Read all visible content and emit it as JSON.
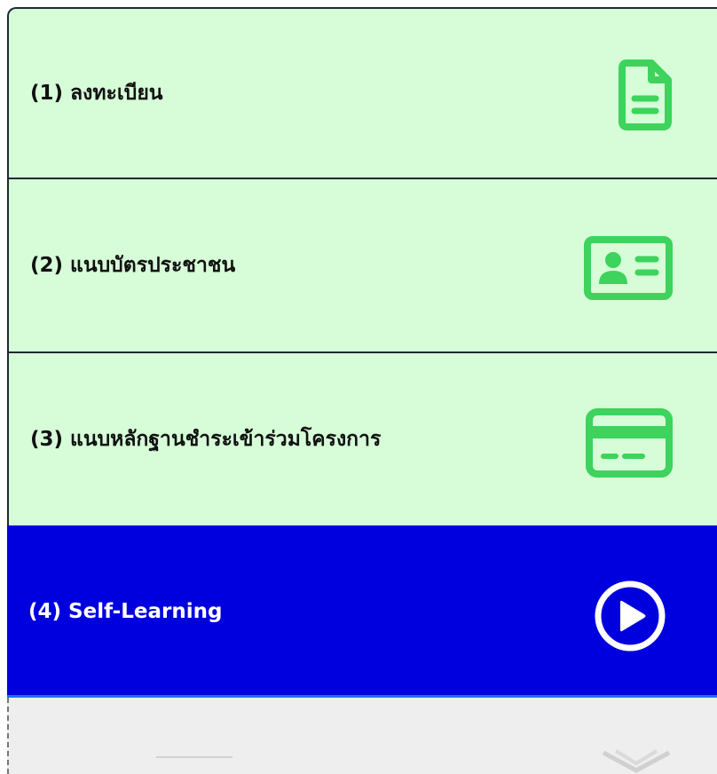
{
  "steps": [
    {
      "label": "(1) ลงทะเบียน",
      "icon": "document-icon",
      "status": "completed"
    },
    {
      "label": "(2) แนบบัตรประชาชน",
      "icon": "id-card-icon",
      "status": "completed"
    },
    {
      "label": "(3) แนบหลักฐานชำระเข้าร่วมโครงการ",
      "icon": "credit-card-icon",
      "status": "completed"
    },
    {
      "label": "(4) Self-Learning",
      "icon": "play-circle-icon",
      "status": "active"
    }
  ],
  "next_step": {
    "icon": "book-icon",
    "status": "locked"
  },
  "colors": {
    "completed_bg": "#d6fdd8",
    "completed_icon": "#3dd35c",
    "active_bg": "#0000df",
    "active_text": "#ffffff",
    "locked_bg": "#eeeeee"
  }
}
